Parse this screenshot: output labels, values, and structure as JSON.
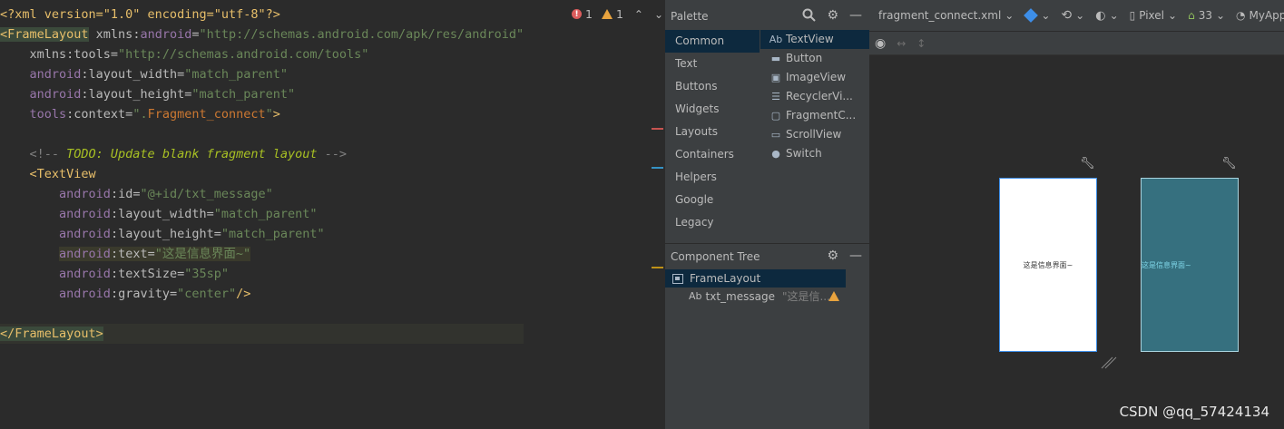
{
  "editor": {
    "lines": [
      {
        "parts": [
          {
            "t": "<?xml version=\"1.0\" encoding=\"utf-8\"?>",
            "c": "c-punc"
          }
        ]
      },
      {
        "parts": [
          {
            "t": "<FrameLayout",
            "c": "c-tagbg"
          },
          {
            "t": " xmlns:",
            "c": "c-attr"
          },
          {
            "t": "android",
            "c": "c-ns"
          },
          {
            "t": "=",
            "c": "c-attr"
          },
          {
            "t": "\"http://schemas.android.com/apk/res/android\"",
            "c": "c-val"
          }
        ]
      },
      {
        "parts": [
          {
            "t": "    xmlns:tools=",
            "c": "c-attr"
          },
          {
            "t": "\"http://schemas.android.com/tools\"",
            "c": "c-val"
          }
        ]
      },
      {
        "parts": [
          {
            "t": "    ",
            "c": "c-attr"
          },
          {
            "t": "android",
            "c": "c-ns"
          },
          {
            "t": ":layout_width=",
            "c": "c-attr"
          },
          {
            "t": "\"match_parent\"",
            "c": "c-val"
          }
        ]
      },
      {
        "parts": [
          {
            "t": "    ",
            "c": "c-attr"
          },
          {
            "t": "android",
            "c": "c-ns"
          },
          {
            "t": ":layout_height=",
            "c": "c-attr"
          },
          {
            "t": "\"match_parent\"",
            "c": "c-val"
          }
        ]
      },
      {
        "parts": [
          {
            "t": "    ",
            "c": "c-attr"
          },
          {
            "t": "tools",
            "c": "c-ns"
          },
          {
            "t": ":context=",
            "c": "c-attr"
          },
          {
            "t": "\".",
            "c": "c-val"
          },
          {
            "t": "Fragment_connect",
            "c": "c-ctx"
          },
          {
            "t": "\"",
            "c": "c-val"
          },
          {
            "t": ">",
            "c": "c-tag"
          }
        ]
      },
      {
        "parts": [
          {
            "t": "",
            "c": "c-attr"
          }
        ]
      },
      {
        "parts": [
          {
            "t": "    <!-- ",
            "c": "c-cmt"
          },
          {
            "t": "TODO: Update blank fragment layout",
            "c": "c-todo"
          },
          {
            "t": " -->",
            "c": "c-cmt"
          }
        ]
      },
      {
        "parts": [
          {
            "t": "    <TextView",
            "c": "c-tag"
          }
        ]
      },
      {
        "parts": [
          {
            "t": "        ",
            "c": "c-attr"
          },
          {
            "t": "android",
            "c": "c-ns"
          },
          {
            "t": ":id=",
            "c": "c-attr"
          },
          {
            "t": "\"@+id/txt_message\"",
            "c": "c-val"
          }
        ]
      },
      {
        "parts": [
          {
            "t": "        ",
            "c": "c-attr"
          },
          {
            "t": "android",
            "c": "c-ns"
          },
          {
            "t": ":layout_width=",
            "c": "c-attr"
          },
          {
            "t": "\"match_parent\"",
            "c": "c-val"
          }
        ]
      },
      {
        "parts": [
          {
            "t": "        ",
            "c": "c-attr"
          },
          {
            "t": "android",
            "c": "c-ns"
          },
          {
            "t": ":layout_height=",
            "c": "c-attr"
          },
          {
            "t": "\"match_parent\"",
            "c": "c-val"
          }
        ]
      },
      {
        "parts": [
          {
            "t": "        ",
            "c": "c-attr"
          },
          {
            "t": "android",
            "c": "c-ns textattr"
          },
          {
            "t": ":text=",
            "c": "c-attr textattr"
          },
          {
            "t": "\"这是信息界面~\"",
            "c": "c-val textattr"
          }
        ]
      },
      {
        "parts": [
          {
            "t": "        ",
            "c": "c-attr"
          },
          {
            "t": "android",
            "c": "c-ns"
          },
          {
            "t": ":textSize=",
            "c": "c-attr"
          },
          {
            "t": "\"35sp\"",
            "c": "c-val"
          }
        ]
      },
      {
        "parts": [
          {
            "t": "        ",
            "c": "c-attr"
          },
          {
            "t": "android",
            "c": "c-ns"
          },
          {
            "t": ":gravity=",
            "c": "c-attr"
          },
          {
            "t": "\"center\"",
            "c": "c-val"
          },
          {
            "t": "/>",
            "c": "c-tag"
          }
        ]
      },
      {
        "parts": [
          {
            "t": "",
            "c": "c-attr"
          }
        ]
      },
      {
        "parts": [
          {
            "t": "</FrameLayout>",
            "c": "c-tagbg"
          }
        ],
        "hl": true
      }
    ],
    "inspections": {
      "errors": "1",
      "warnings": "1"
    }
  },
  "palette": {
    "title": "Palette",
    "categories": [
      "Common",
      "Text",
      "Buttons",
      "Widgets",
      "Layouts",
      "Containers",
      "Helpers",
      "Google",
      "Legacy"
    ],
    "selected_category": 0,
    "widgets": [
      {
        "icon": "Ab",
        "label": "TextView"
      },
      {
        "icon": "▬",
        "label": "Button"
      },
      {
        "icon": "▣",
        "label": "ImageView"
      },
      {
        "icon": "☰",
        "label": "RecyclerVi..."
      },
      {
        "icon": "▢",
        "label": "FragmentC..."
      },
      {
        "icon": "▭",
        "label": "ScrollView"
      },
      {
        "icon": "●",
        "label": "Switch"
      }
    ],
    "selected_widget": 0
  },
  "tree": {
    "title": "Component Tree",
    "root": "FrameLayout",
    "child_icon": "Ab",
    "child_id": "txt_message",
    "child_text": "\"这是信..."
  },
  "design": {
    "file": "fragment_connect.xml",
    "device": "Pixel",
    "api": "33",
    "app": "MyApplicati",
    "preview_text": "这是信息界面~",
    "blueprint_text": "这是信息界面~"
  },
  "watermark": "CSDN @qq_57424134",
  "colors": {
    "accent": "#3d8ee8",
    "error": "#db5c5c",
    "warning": "#e8a33e"
  }
}
